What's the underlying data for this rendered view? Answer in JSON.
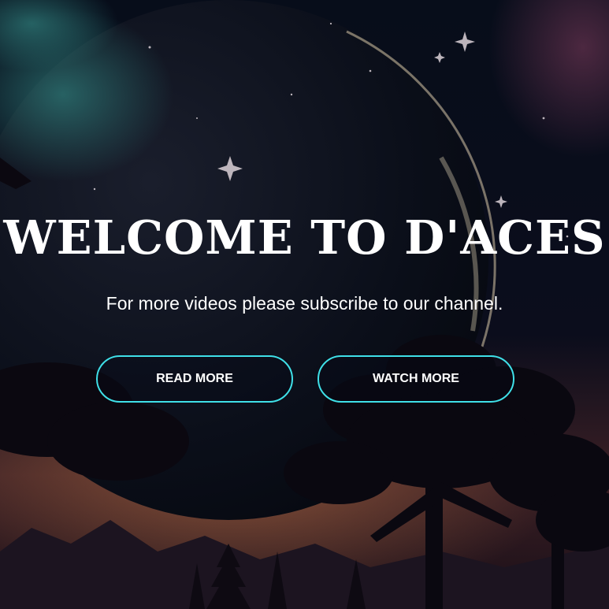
{
  "hero": {
    "title": "WELCOME TO D'ACES",
    "subtitle": "For more videos please subscribe to our channel.",
    "read_more_label": "READ MORE",
    "watch_more_label": "WATCH MORE"
  },
  "colors": {
    "button_border": "#3fe0e8",
    "text": "#ffffff",
    "sky_dark": "#050a14"
  }
}
